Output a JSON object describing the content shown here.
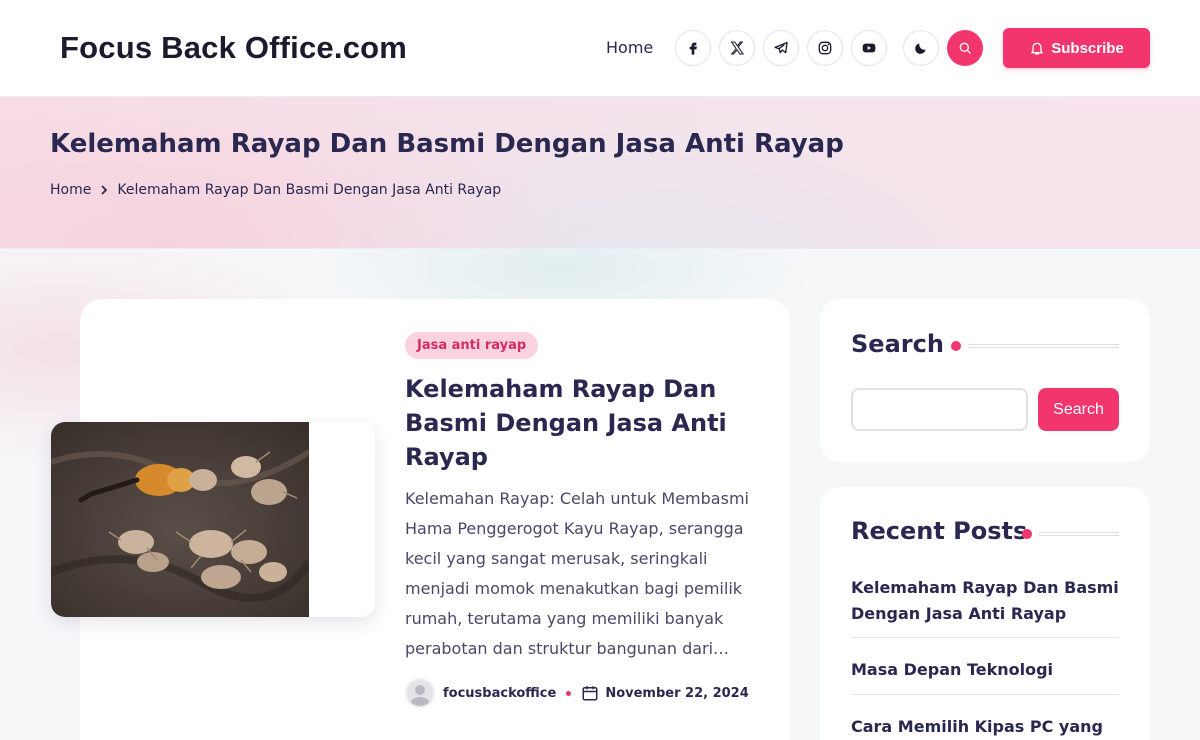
{
  "header": {
    "site_title": "Focus Back Office.com",
    "nav_home": "Home",
    "subscribe_label": "Subscribe",
    "social_icons": [
      "facebook-icon",
      "x-twitter-icon",
      "telegram-icon",
      "instagram-icon",
      "youtube-icon"
    ],
    "accent_color": "#f2356d"
  },
  "hero": {
    "title": "Kelemaham Rayap Dan Basmi Dengan Jasa Anti Rayap",
    "breadcrumb": {
      "home": "Home",
      "current": "Kelemaham Rayap Dan Basmi Dengan Jasa Anti Rayap"
    }
  },
  "post": {
    "category": "Jasa anti rayap",
    "title": "Kelemaham Rayap Dan Basmi Dengan Jasa Anti Rayap",
    "excerpt": "Kelemahan Rayap: Celah untuk Membasmi Hama Penggerogot Kayu Rayap, serangga kecil yang sangat merusak, seringkali menjadi momok menakutkan bagi pemilik rumah, terutama yang memiliki banyak perabotan dan struktur bangunan dari…",
    "author": "focusbackoffice",
    "date": "November 22, 2024"
  },
  "sidebar": {
    "search": {
      "title": "Search",
      "button_label": "Search",
      "input_value": ""
    },
    "recent": {
      "title": "Recent Posts",
      "items": [
        "Kelemaham Rayap Dan Basmi Dengan Jasa Anti Rayap",
        "Masa Depan Teknologi",
        "Cara Memilih Kipas PC yang"
      ]
    }
  }
}
